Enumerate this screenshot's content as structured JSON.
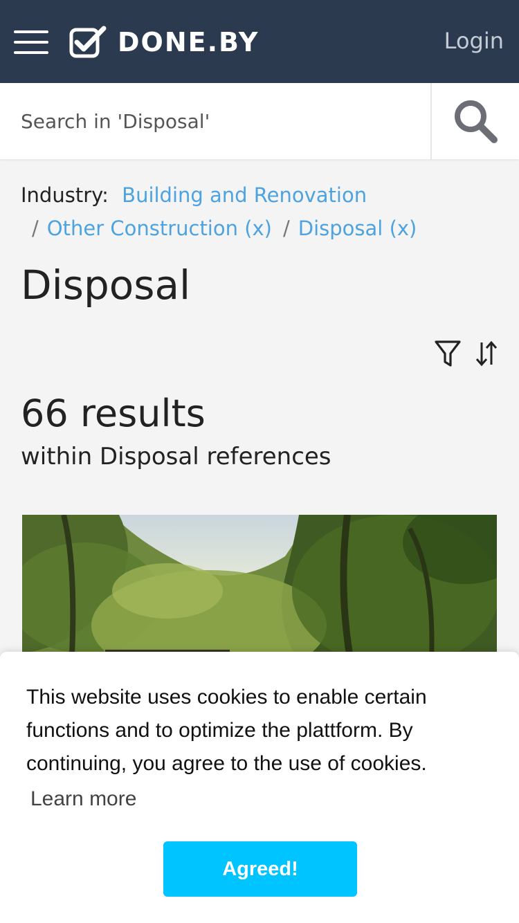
{
  "header": {
    "logo_text": "DONE.BY",
    "login_label": "Login",
    "background_color": "#2b3a4e"
  },
  "search": {
    "placeholder": "Search in 'Disposal'",
    "icon": "search-icon"
  },
  "breadcrumb": {
    "label": "Industry:",
    "items": [
      {
        "label": "Building and Renovation"
      },
      {
        "label": "Other Construction (x)"
      },
      {
        "label": "Disposal (x)"
      }
    ],
    "separator": "/",
    "link_color": "#4da3e0"
  },
  "page": {
    "title": "Disposal"
  },
  "toolbar": {
    "icons": [
      "filter-icon",
      "sort-icon"
    ]
  },
  "results": {
    "count_text": "66 results",
    "subtitle": "within Disposal references"
  },
  "cookie_banner": {
    "message": "This website uses cookies to enable certain functions and to optimize the plattform. By continuing, you agree to the use of cookies.",
    "learn_more_label": "Learn more",
    "agree_label": "Agreed!",
    "button_color": "#00c4ff"
  }
}
